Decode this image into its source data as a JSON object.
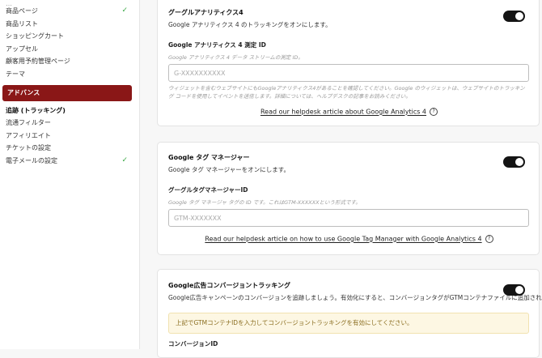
{
  "sidebar": {
    "items": [
      {
        "label": "商品ページ",
        "checked": true
      },
      {
        "label": "商品リスト",
        "checked": false
      },
      {
        "label": "ショッピングカート",
        "checked": false
      },
      {
        "label": "アップセル",
        "checked": false
      },
      {
        "label": "顧客用予約管理ページ",
        "checked": false
      },
      {
        "label": "テーマ",
        "checked": false
      }
    ],
    "section_header": "アドバンス",
    "advanced_items": [
      {
        "label": "追跡 (トラッキング)",
        "active": true,
        "checked": false
      },
      {
        "label": "流通フィルター",
        "checked": false
      },
      {
        "label": "アフィリエイト",
        "checked": false
      },
      {
        "label": "チケットの設定",
        "checked": false
      },
      {
        "label": "電子メールの設定",
        "checked": true
      }
    ],
    "check_glyph": "✓"
  },
  "ga4": {
    "title": "グーグルアナリティクス4",
    "description": "Google アナリティクス 4 のトラッキングをオンにします。",
    "enabled": true,
    "field_label": "Google アナリティクス 4 測定 ID",
    "field_help": "Google アナリティクス 4 データ ストリームの測定 ID。",
    "placeholder": "G-XXXXXXXXXX",
    "warning": "ウィジェットを含むウェブサイトにもGoogleアナリティクス4があることを確認してください。Google のウィジェットは、ウェブサイトのトラッキング コードを使用してイベントを送信します。詳細については、ヘルプデスクの記事をお読みください。",
    "help_link": "Read our helpdesk article about Google Analytics 4"
  },
  "gtm": {
    "title": "Google タグ マネージャー",
    "description": "Google タグ マネージャーをオンにします。",
    "enabled": true,
    "field_label": "グーグルタグマネージャーID",
    "field_help": "Google タグ マネージャ タグの ID です。これはGTM-XXXXXXという形式です。",
    "placeholder": "GTM-XXXXXXX",
    "help_link": "Read our helpdesk article on how to use Google Tag Manager with Google Analytics 4"
  },
  "gads": {
    "title": "Google広告コンバージョントラッキング",
    "description": "Google広告キャンペーンのコンバージョンを追跡しましょう。有効化にすると、コンバージョンタグがGTMコンテナファイルに追加されます。",
    "enabled": true,
    "notice": "上記でGTMコンテナIDを入力してコンバージョントラッキングを有効にしてください。",
    "field_label": "コンバージョンID"
  },
  "colors": {
    "accent": "#8a1717",
    "check": "#3aa845",
    "toggle_on": "#141414"
  }
}
